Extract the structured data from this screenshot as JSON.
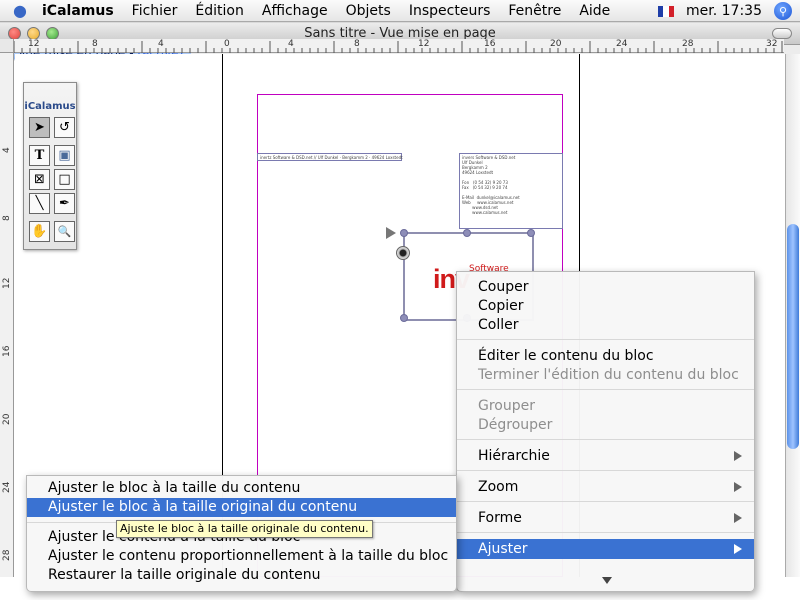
{
  "colors": {
    "accent": "#3a72d2",
    "close": "#e0443e",
    "minimize": "#e8ad2d",
    "maximize": "#3ea33a",
    "logo_red": "#d01a1a",
    "margin_guide": "#c000c0"
  },
  "menubar": {
    "apple_icon": "apple-icon",
    "app": "iCalamus",
    "items": [
      "Fichier",
      "Édition",
      "Affichage",
      "Objets",
      "Inspecteurs",
      "Fenêtre",
      "Aide"
    ],
    "flag_icon": "french-flag-icon",
    "clock": "mer. 17:35",
    "spotlight_icon": "spotlight-icon"
  },
  "window": {
    "title": "Sans titre - Vue mise en page",
    "view_badge": "Vue mise en page",
    "view_badge_sep": " - ",
    "view_badge_state": "(active)"
  },
  "rulers": {
    "h_labels": [
      "12",
      "8",
      "4",
      "0",
      "4",
      "8",
      "12",
      "16",
      "20",
      "24",
      "28",
      "32"
    ],
    "v_labels": [
      "4",
      "8",
      "12",
      "16",
      "20",
      "24",
      "28"
    ]
  },
  "palette": {
    "title": "iCalamus",
    "tools": [
      {
        "name": "arrow-tool-icon",
        "glyph": "➤"
      },
      {
        "name": "lasso-tool-icon",
        "glyph": "↺"
      },
      {
        "name": "text-tool-icon",
        "glyph": "T"
      },
      {
        "name": "image-tool-icon",
        "glyph": "▣"
      },
      {
        "name": "image-frame-tool-icon",
        "glyph": "⊠"
      },
      {
        "name": "rectangle-tool-icon",
        "glyph": "□"
      },
      {
        "name": "line-tool-icon",
        "glyph": "╲"
      },
      {
        "name": "pen-tool-icon",
        "glyph": "✒"
      },
      {
        "name": "hand-tool-icon",
        "glyph": "✋"
      },
      {
        "name": "zoom-tool-icon",
        "glyph": "🔍"
      }
    ]
  },
  "document": {
    "sender_line": "inertz Software & DSD.net // Ulf Dunkel · Bergkamm 2 · 49624 Loxstedt",
    "address_block": "invers Software & DSD.net\nUlf Dunkel\nBergkamm 2\n49624 Loxstedt\n\nFon   (0 54 32) 9 20 73\nFax   (0 54 32) 9 20 74\n\nE-Mail  dunkel@icalamus.net\nWeb     www.icalamus.net\n        www.dsd.net\n        www.calamus.net",
    "logo_text": "inv",
    "logo_subtext": "Software"
  },
  "context_menu": {
    "items": [
      {
        "label": "Couper",
        "enabled": true
      },
      {
        "label": "Copier",
        "enabled": true
      },
      {
        "label": "Coller",
        "enabled": true
      },
      {
        "label": "Éditer le contenu du bloc",
        "enabled": true
      },
      {
        "label": "Terminer l'édition du contenu du bloc",
        "enabled": false
      },
      {
        "label": "Grouper",
        "enabled": false
      },
      {
        "label": "Dégrouper",
        "enabled": false
      },
      {
        "label": "Hiérarchie",
        "enabled": true,
        "submenu": true
      },
      {
        "label": "Zoom",
        "enabled": true,
        "submenu": true
      },
      {
        "label": "Forme",
        "enabled": true,
        "submenu": true
      },
      {
        "label": "Ajuster",
        "enabled": true,
        "submenu": true,
        "highlighted": true
      }
    ]
  },
  "submenu": {
    "items": [
      {
        "label": "Ajuster le bloc à la taille du contenu"
      },
      {
        "label": "Ajuster le bloc à la taille original du contenu",
        "highlighted": true
      },
      {
        "label": "Ajuster le contenu à la taille du bloc"
      },
      {
        "label": "Ajuster le contenu proportionnellement à la taille du bloc"
      },
      {
        "label": "Restaurer la taille originale du contenu"
      }
    ],
    "tooltip": "Ajuste le bloc à la taille originale du contenu."
  }
}
